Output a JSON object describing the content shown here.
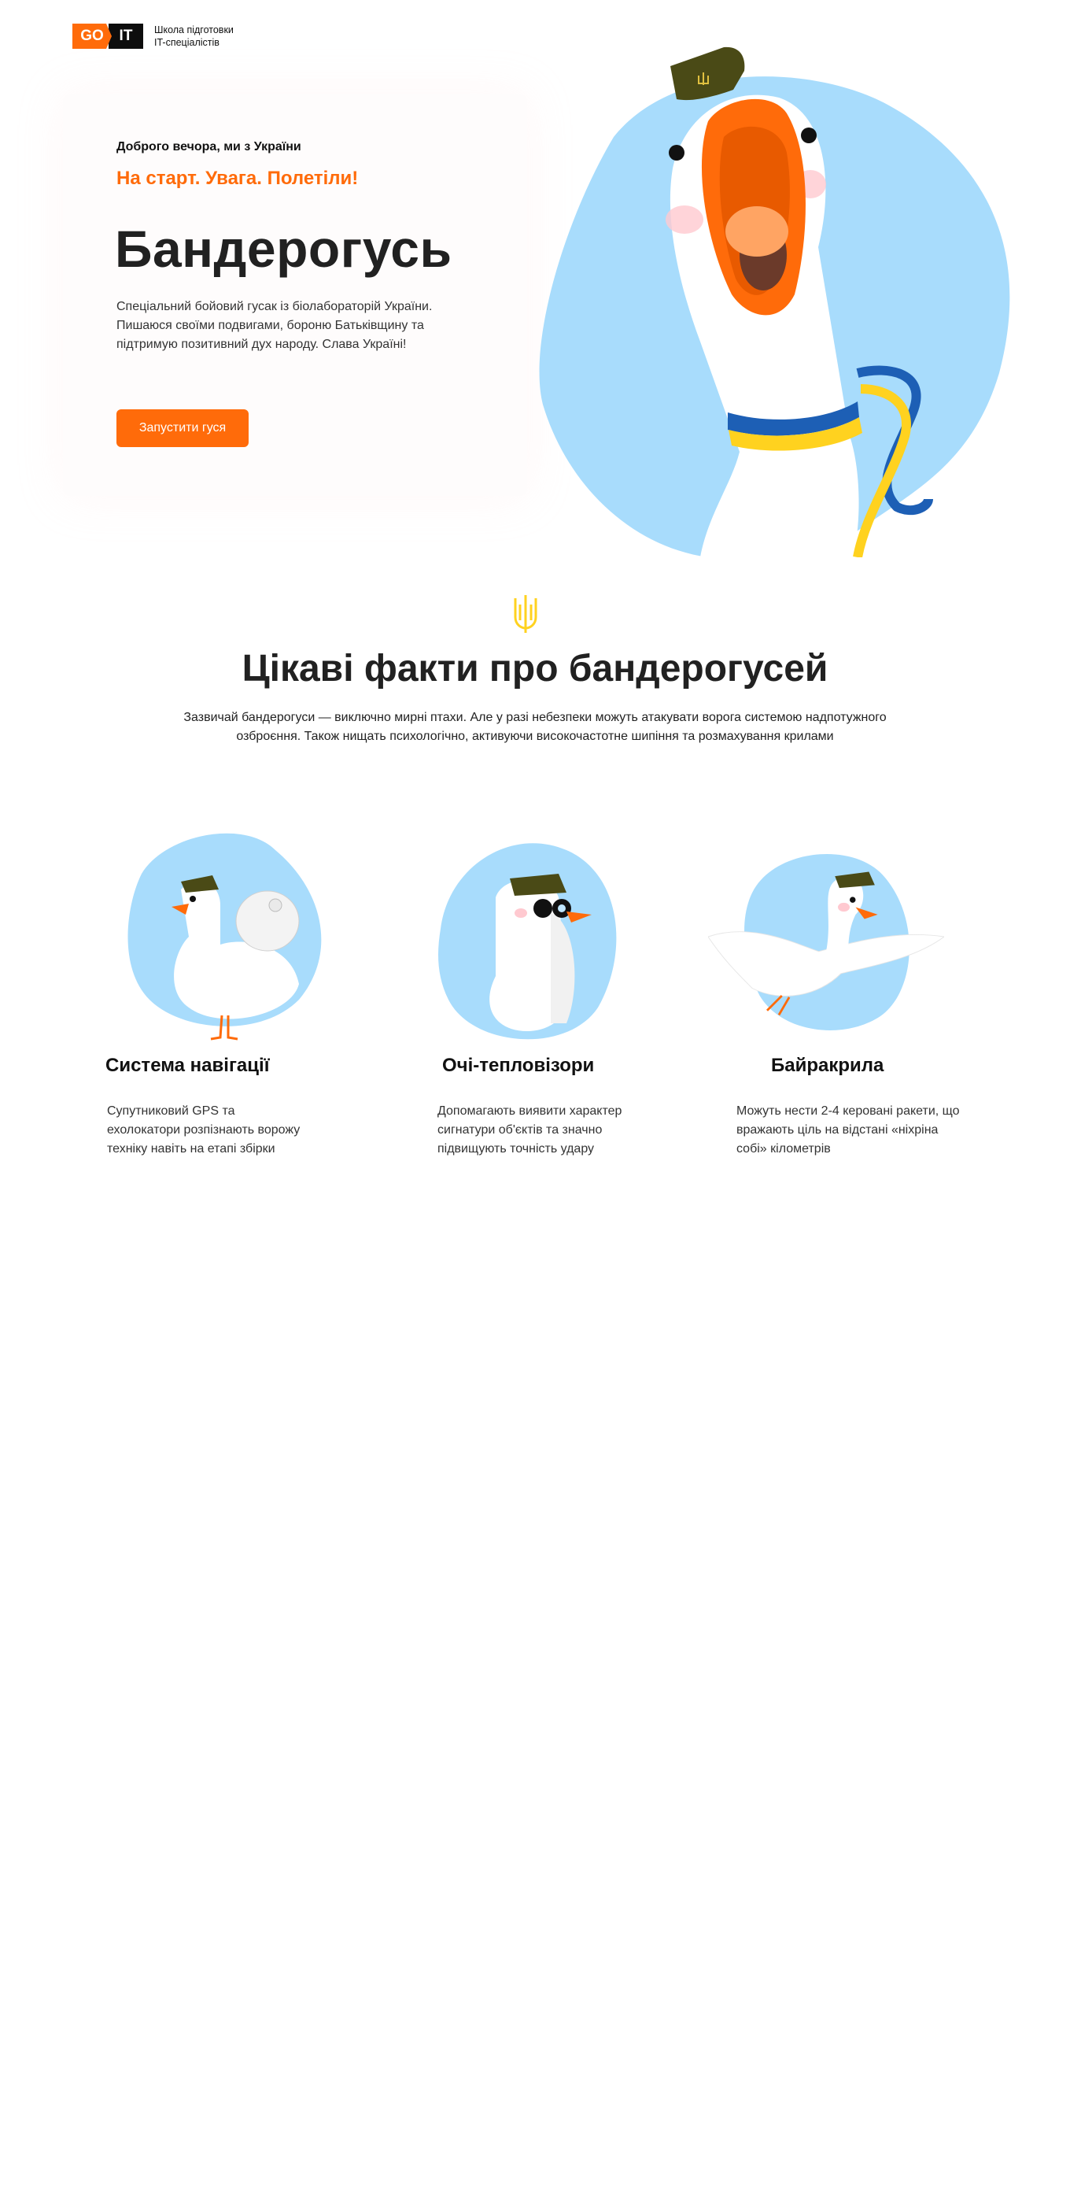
{
  "header": {
    "logo_go": "GO",
    "logo_it": "IT",
    "school_line1": "Школа підготовки",
    "school_line2": "IT-спеціалістів"
  },
  "hero": {
    "greeting": "Доброго вечора, ми з України",
    "slogan": "На старт. Увага. Полетіли!",
    "title": "Бандерогусь",
    "description": "Спеціальний бойовий гусак із біолабораторій України. Пишаюся своїми подвигами, бороню Батьківщину та підтримую позитивний дух народу. Слава Україні!",
    "button_label": "Запустити гуся"
  },
  "facts": {
    "title": "Цікаві факти про бандерогусей",
    "description": "Зазвичай бандерогуси — виключно мирні птахи. Але у разі небезпеки можуть атакувати ворога системою надпотужного озброєння. Також нищать психологічно, активуючи високочастотне шипіння та розмахування крилами",
    "cards": [
      {
        "title": "Система навігації",
        "text": "Супутниковий GPS та ехолокатори розпізнають ворожу техніку навіть на етапі збірки"
      },
      {
        "title": "Очі-тепловізори",
        "text": "Допомагають виявити характер сигнатури об'єктів та значно підвищують точність удару"
      },
      {
        "title": "Байракрила",
        "text": "Можуть нести 2-4 керовані ракети, що вражають ціль на відстані «ніхріна собі» кілометрів"
      }
    ]
  },
  "colors": {
    "accent": "#ff6b0a",
    "sky": "#a8dcfc",
    "cap": "#4a4a16",
    "ribbon_blue": "#1d5fb5",
    "ribbon_yellow": "#ffd21f"
  },
  "icons": [
    "trident-icon",
    "military-cap-icon"
  ]
}
